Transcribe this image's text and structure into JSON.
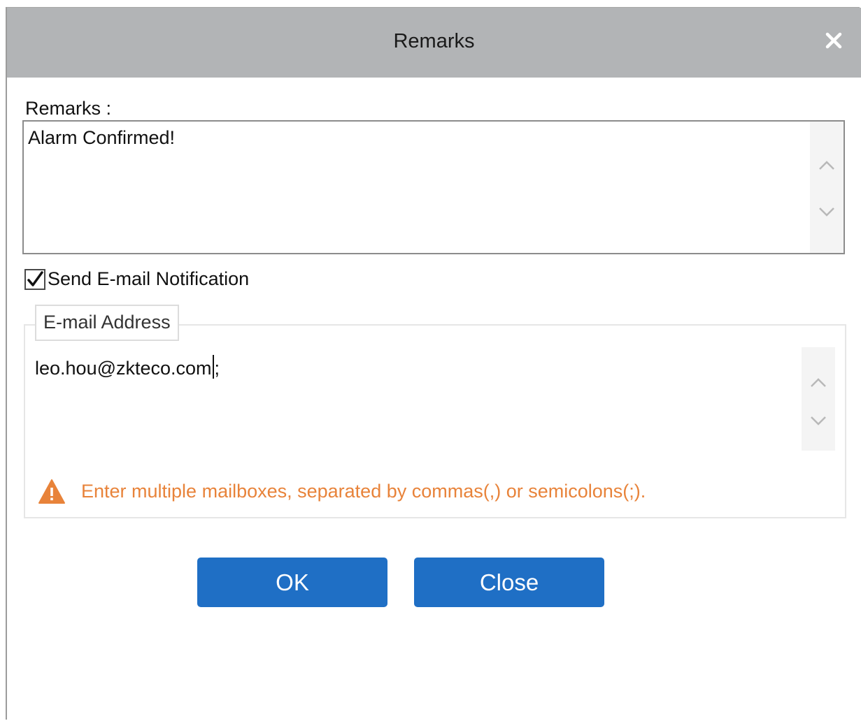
{
  "dialog": {
    "title": "Remarks",
    "close_icon": "close-icon"
  },
  "remarks": {
    "label": "Remarks :",
    "value": "Alarm Confirmed!"
  },
  "email_notification": {
    "checked": true,
    "label": "Send E-mail Notification",
    "legend": "E-mail Address",
    "value_before_caret": "leo.hou@zkteco.com",
    "value_after_caret": ";",
    "warning_icon": "warning-icon",
    "warning": "Enter multiple mailboxes, separated by commas(,) or semicolons(;)."
  },
  "buttons": {
    "ok": "OK",
    "close": "Close"
  },
  "colors": {
    "titlebar": "#b2b4b6",
    "button": "#1f6fc5",
    "warning": "#e8833a"
  }
}
